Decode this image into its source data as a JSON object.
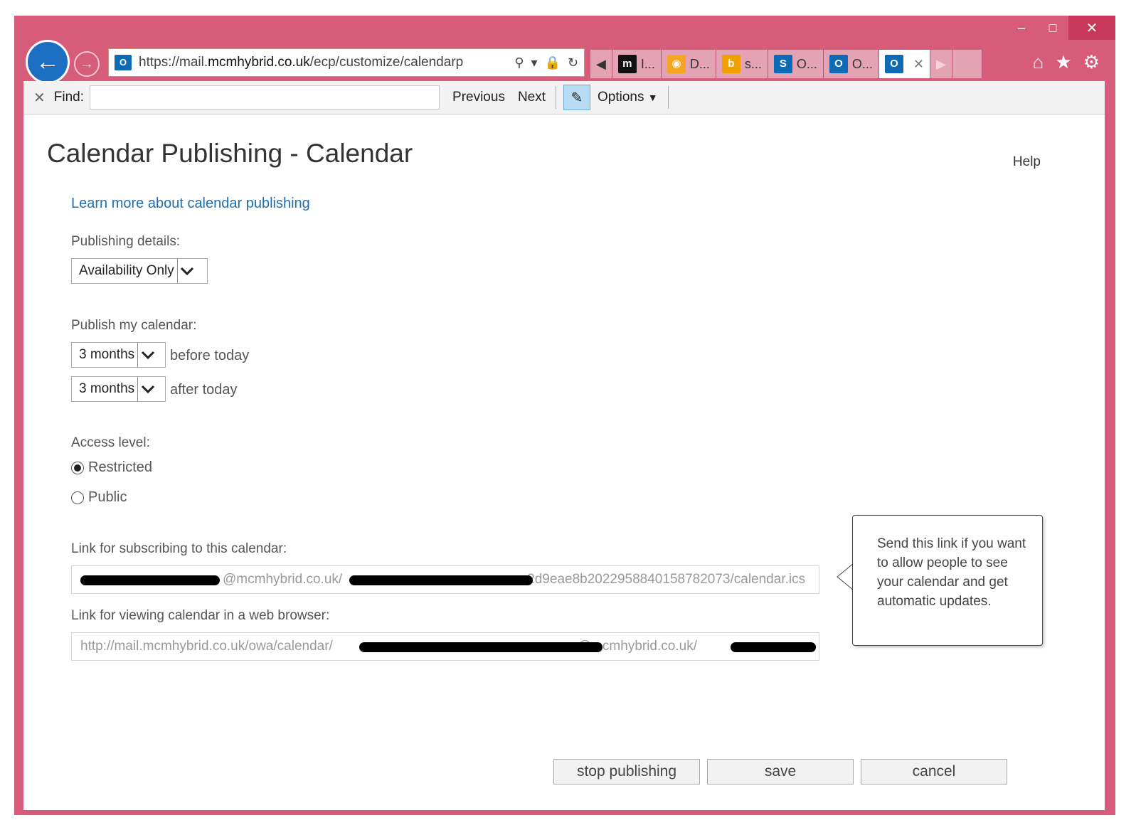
{
  "browser": {
    "url_prefix": "https://mail.",
    "url_host": "mcmhybrid.co.uk",
    "url_path": "/ecp/customize/calendarp",
    "tabs": [
      {
        "label": "I...",
        "icon": "m"
      },
      {
        "label": "D...",
        "icon": "eye"
      },
      {
        "label": "s...",
        "icon": "b"
      },
      {
        "label": "O...",
        "icon": "S"
      },
      {
        "label": "O...",
        "icon": "O"
      },
      {
        "label": "",
        "icon": "O"
      }
    ]
  },
  "find": {
    "label": "Find:",
    "previous": "Previous",
    "next": "Next",
    "options": "Options"
  },
  "page": {
    "title": "Calendar Publishing - Calendar",
    "help": "Help",
    "learn_more": "Learn more about calendar publishing",
    "publishing_details_label": "Publishing details:",
    "publishing_details_value": "Availability Only",
    "publish_label": "Publish my calendar:",
    "before_value": "3 months",
    "before_suffix": "before today",
    "after_value": "3 months",
    "after_suffix": "after today",
    "access_label": "Access level:",
    "access_restricted": "Restricted",
    "access_public": "Public",
    "subscribe_label": "Link for subscribing to this calendar:",
    "subscribe_value_mid": "@mcmhybrid.co.uk/",
    "subscribe_value_end": "2d9eae8b2022958840158782073/calendar.ics",
    "browser_label": "Link for viewing calendar in a web browser:",
    "browser_value_start": "http://mail.mcmhybrid.co.uk/owa/calendar/",
    "browser_value_mid": "@mcmhybrid.co.uk/",
    "callout": "Send this link if you want to allow people to see your calendar and get automatic updates."
  },
  "actions": {
    "stop": "stop publishing",
    "save": "save",
    "cancel": "cancel"
  },
  "colors": {
    "frame": "#d65c79",
    "link": "#1e6fb0",
    "back_button": "#1d6fc4"
  }
}
